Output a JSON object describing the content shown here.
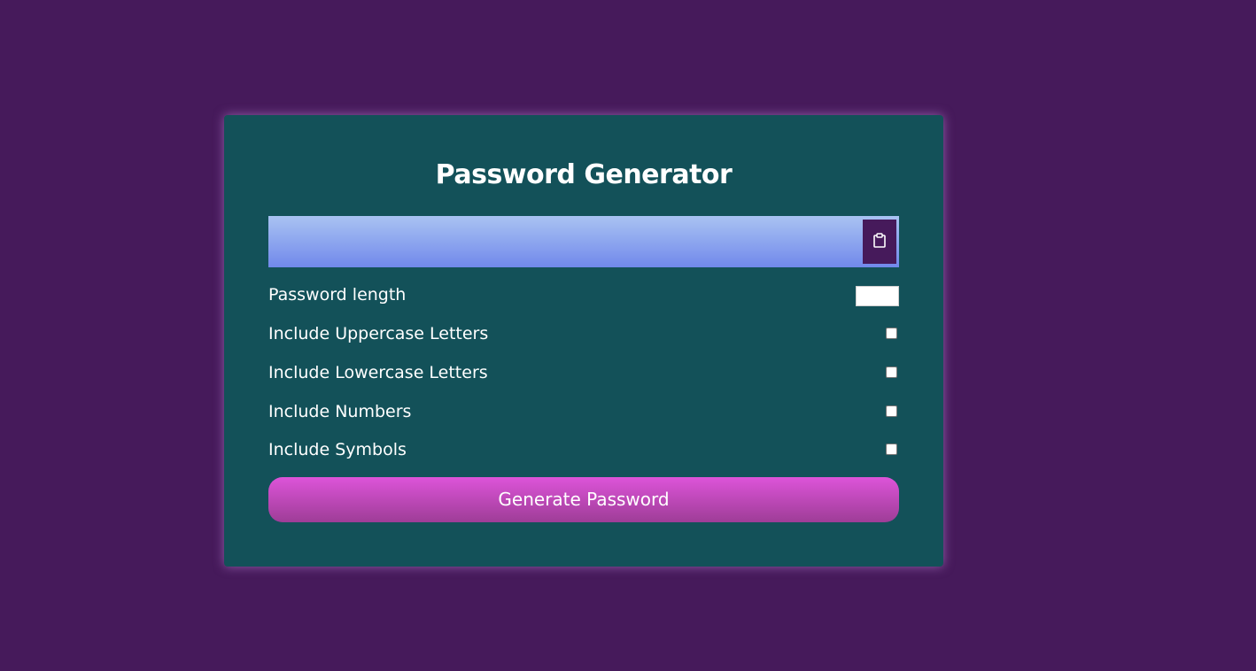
{
  "app": {
    "title": "Password Generator"
  },
  "result": {
    "value": "",
    "copy_icon": "clipboard-icon"
  },
  "settings": [
    {
      "key": "length",
      "label": "Password length",
      "control": "number",
      "value": ""
    },
    {
      "key": "uppercase",
      "label": "Include Uppercase Letters",
      "control": "checkbox",
      "checked": false
    },
    {
      "key": "lowercase",
      "label": "Include Lowercase Letters",
      "control": "checkbox",
      "checked": false
    },
    {
      "key": "numbers",
      "label": "Include Numbers",
      "control": "checkbox",
      "checked": false
    },
    {
      "key": "symbols",
      "label": "Include Symbols",
      "control": "checkbox",
      "checked": false
    }
  ],
  "actions": {
    "generate_label": "Generate Password"
  },
  "colors": {
    "page_background": "#461a5b",
    "card_background": "#135159",
    "result_gradient_top": "#a9c3f2",
    "result_gradient_bottom": "#7189eb",
    "copy_button": "#461a5b",
    "generate_gradient_top": "#dd54d9",
    "generate_gradient_bottom": "#9e3d97",
    "text": "#ffffff"
  }
}
